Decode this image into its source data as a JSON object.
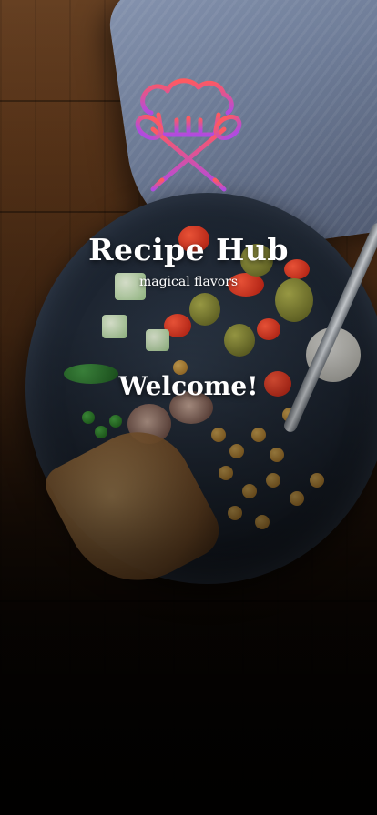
{
  "app": {
    "title": "Recipe Hub",
    "tagline": "magical flavors"
  },
  "welcome_text": "Welcome!",
  "logo": {
    "icon": "chef-hat-crossed-utensils-icon",
    "gradient_start": "#ff5a5f",
    "gradient_end": "#b04be0"
  },
  "background": {
    "image": "food-bowl-on-wooden-table-photo"
  }
}
